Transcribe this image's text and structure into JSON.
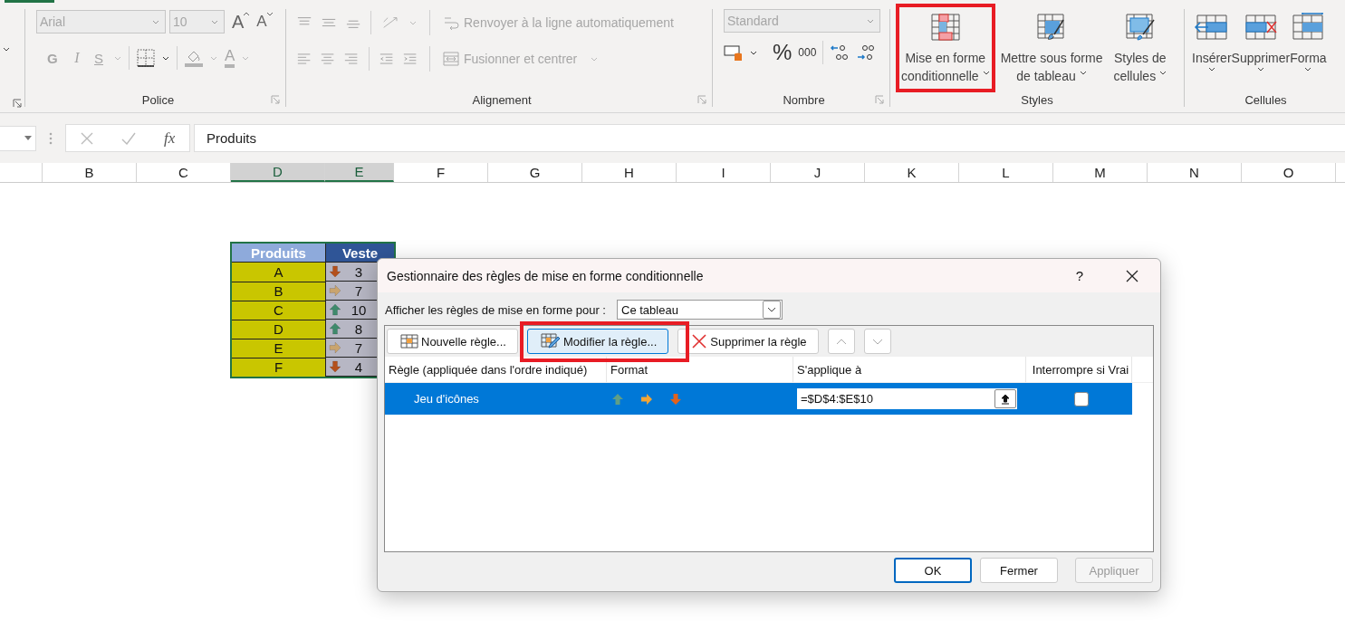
{
  "ribbon": {
    "font": {
      "label": "Police",
      "disabled": true,
      "font_name": "Arial",
      "font_size": "10",
      "grow": "A",
      "shrink": "A",
      "bold": "G",
      "italic": "I",
      "underline": "S",
      "font_color": "A"
    },
    "alignment": {
      "label": "Alignement",
      "disabled": true,
      "wrap_text": "Renvoyer à la ligne automatiquement",
      "merge_center": "Fusionner et centrer"
    },
    "number": {
      "label": "Nombre",
      "format": "Standard",
      "percent": "%",
      "thousands": "000"
    },
    "styles": {
      "label": "Styles",
      "buttons": [
        {
          "kind": "conditional",
          "lines": [
            "Mise en forme",
            "conditionnelle"
          ],
          "highlighted": true
        },
        {
          "kind": "table",
          "lines": [
            "Mettre sous forme",
            "de tableau"
          ],
          "highlighted": false
        },
        {
          "kind": "cellstyle",
          "lines": [
            "Styles de",
            "cellules"
          ],
          "highlighted": false
        }
      ]
    },
    "cells": {
      "label": "Cellules",
      "buttons": [
        {
          "kind": "insert",
          "label": "Insérer"
        },
        {
          "kind": "delete",
          "label": "Supprimer"
        },
        {
          "kind": "format",
          "label": "Forma"
        }
      ]
    }
  },
  "formula_bar": {
    "fx": "fx",
    "formula": "Produits"
  },
  "columns": [
    {
      "label": "B",
      "selected": false
    },
    {
      "label": "C",
      "selected": false
    },
    {
      "label": "D",
      "selected": true
    },
    {
      "label": "E",
      "selected": true
    },
    {
      "label": "F",
      "selected": false
    },
    {
      "label": "G",
      "selected": false
    },
    {
      "label": "H",
      "selected": false
    },
    {
      "label": "I",
      "selected": false
    },
    {
      "label": "J",
      "selected": false
    },
    {
      "label": "K",
      "selected": false
    },
    {
      "label": "L",
      "selected": false
    },
    {
      "label": "M",
      "selected": false
    },
    {
      "label": "N",
      "selected": false
    },
    {
      "label": "O",
      "selected": false
    }
  ],
  "sheet_table": {
    "headers": [
      "Produits",
      "Veste"
    ],
    "rows": [
      {
        "product": "A",
        "kind": "down",
        "value": "3"
      },
      {
        "product": "B",
        "kind": "right",
        "value": "7"
      },
      {
        "product": "C",
        "kind": "up",
        "value": "10"
      },
      {
        "product": "D",
        "kind": "up",
        "value": "8"
      },
      {
        "product": "E",
        "kind": "right",
        "value": "7"
      },
      {
        "product": "F",
        "kind": "down",
        "value": "4"
      }
    ]
  },
  "dialog": {
    "title": "Gestionnaire des règles de mise en forme conditionnelle",
    "help": "?",
    "show_label": "Afficher les règles de mise en forme pour :",
    "show_value": "Ce tableau",
    "toolbar": [
      {
        "kind": "new",
        "label": "Nouvelle règle...",
        "highlighted": false
      },
      {
        "kind": "edit",
        "label": "Modifier la règle...",
        "highlighted": true
      },
      {
        "kind": "delete",
        "label": "Supprimer la règle",
        "highlighted": false
      }
    ],
    "columns": [
      "Règle (appliquée dans l'ordre indiqué)",
      "Format",
      "S'applique à",
      "Interrompre si Vrai"
    ],
    "rules": [
      {
        "name": "Jeu d'icônes",
        "format_icons": [
          {
            "kind": "up"
          },
          {
            "kind": "right"
          },
          {
            "kind": "down"
          }
        ],
        "applies_to": "=$D$4:$E$10",
        "stop_if_true": false,
        "selected": true
      }
    ],
    "buttons": [
      {
        "label": "OK",
        "default": true,
        "disabled": false
      },
      {
        "label": "Fermer",
        "default": false,
        "disabled": false
      },
      {
        "label": "Appliquer",
        "default": false,
        "disabled": true
      }
    ]
  }
}
